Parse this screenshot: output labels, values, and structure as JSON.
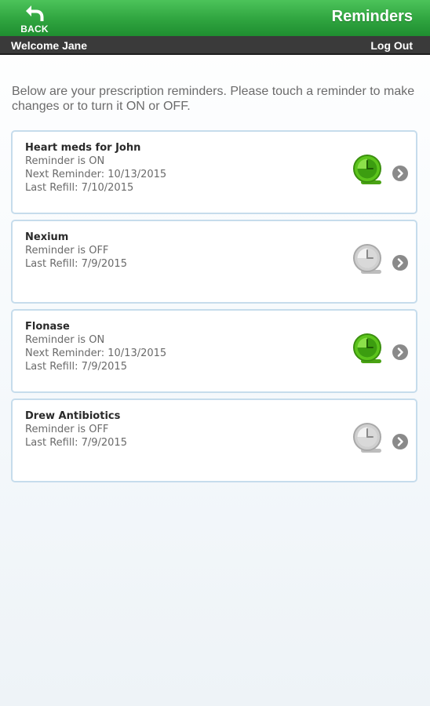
{
  "header": {
    "back_label": "BACK",
    "title": "Reminders",
    "back_icon": "back-arrow-icon"
  },
  "subbar": {
    "welcome": "Welcome Jane",
    "logout": "Log Out"
  },
  "intro": "Below are your prescription reminders. Please touch a reminder to make changes or to turn it ON or OFF.",
  "colors": {
    "brand_green": "#2fa43f",
    "clock_on": "#5cc41c",
    "clock_off": "#cfcfcf",
    "card_border": "#c6dcec"
  },
  "reminders": [
    {
      "name": "Heart meds for John",
      "status": "Reminder is ON",
      "next": "Next Reminder: 10/13/2015",
      "refill": "Last Refill: 7/10/2015",
      "on": true,
      "icon": "clock-on-icon"
    },
    {
      "name": "Nexium",
      "status": "Reminder is OFF",
      "next": "",
      "refill": "Last Refill: 7/9/2015",
      "on": false,
      "icon": "clock-off-icon"
    },
    {
      "name": "Flonase",
      "status": "Reminder is ON",
      "next": "Next Reminder: 10/13/2015",
      "refill": "Last Refill: 7/9/2015",
      "on": true,
      "icon": "clock-on-icon"
    },
    {
      "name": "Drew Antibiotics",
      "status": "Reminder is OFF",
      "next": "",
      "refill": "Last Refill: 7/9/2015",
      "on": false,
      "icon": "clock-off-icon"
    }
  ]
}
